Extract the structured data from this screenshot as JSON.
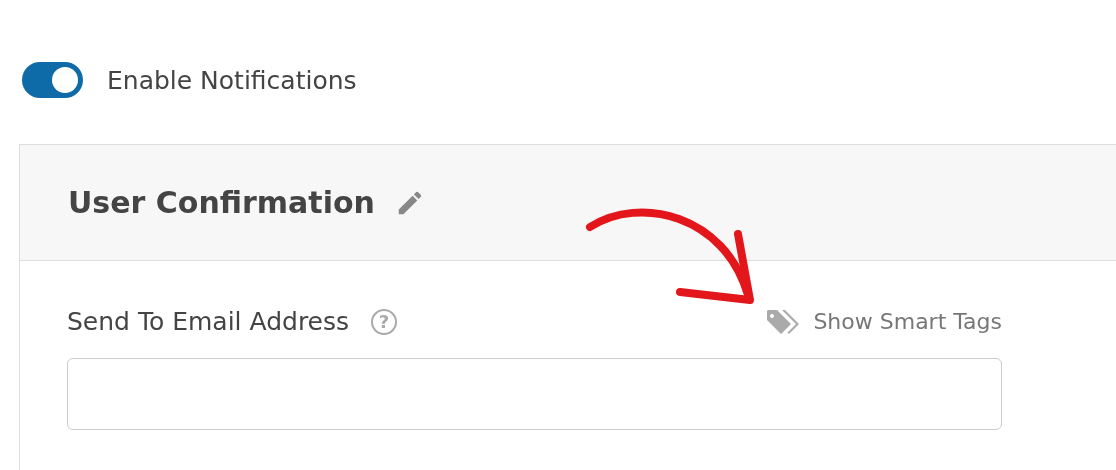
{
  "toggle": {
    "label": "Enable Notifications",
    "on": true
  },
  "panel": {
    "title": "User Confirmation",
    "field": {
      "label": "Send To Email Address",
      "help": "?",
      "smart_tags": "Show Smart Tags"
    }
  }
}
